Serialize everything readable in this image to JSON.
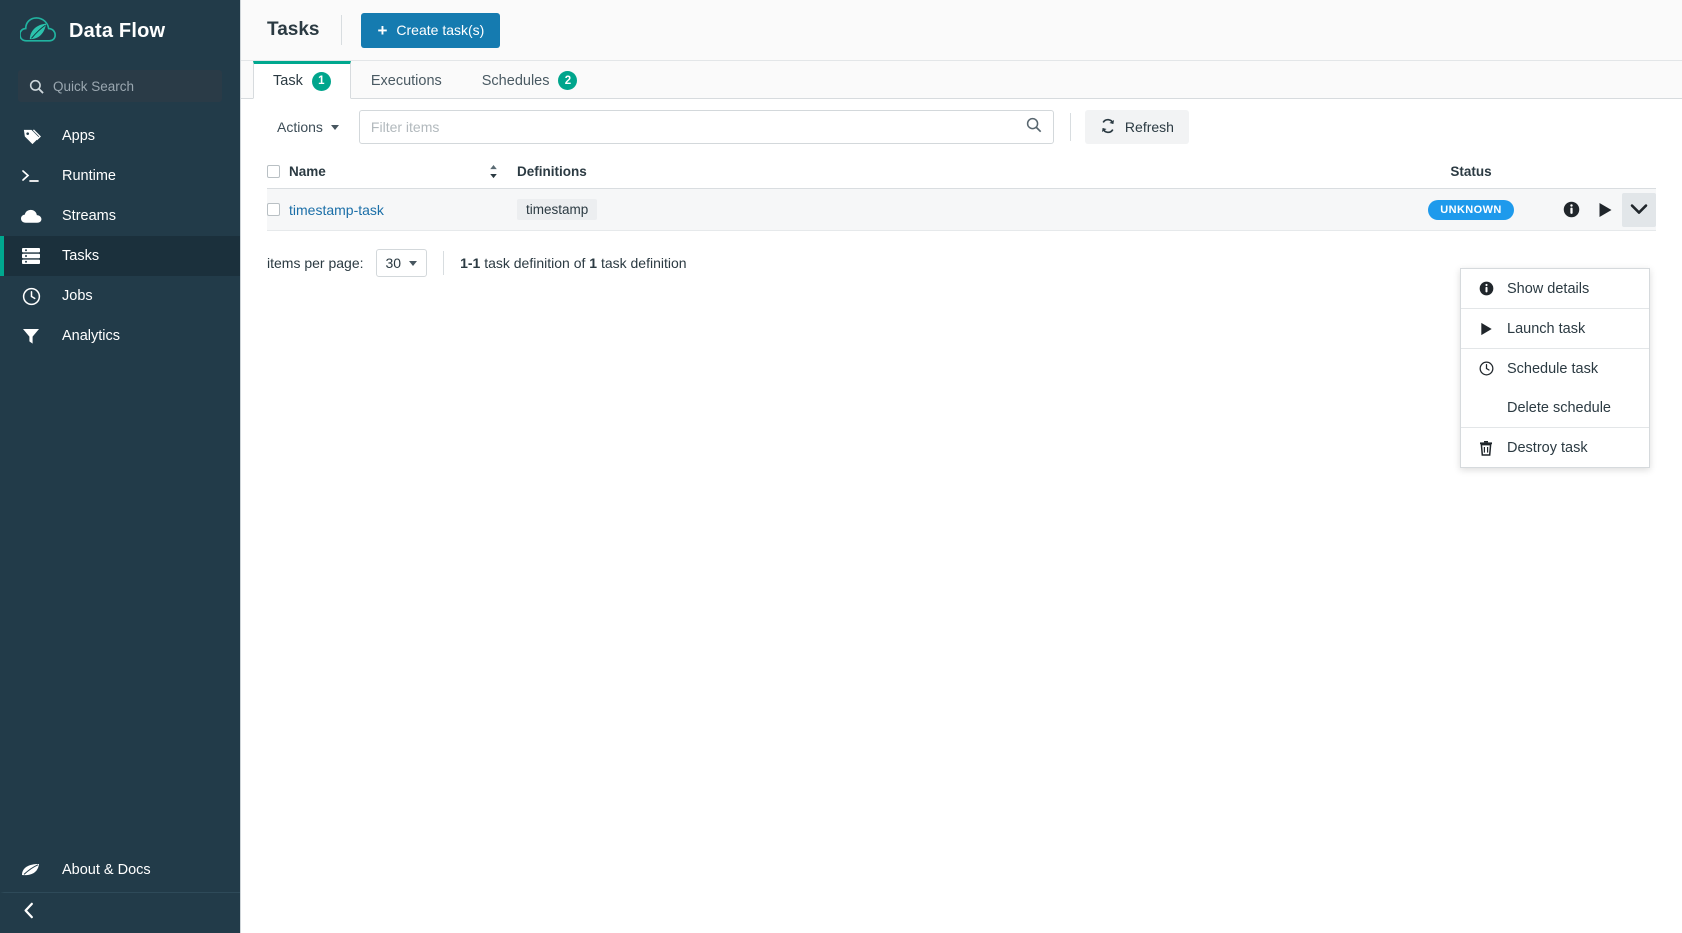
{
  "sidebar": {
    "brand": {
      "title": "Data Flow",
      "logo_icon": "spring-cloud-leaf-logo"
    },
    "search": {
      "placeholder": "Quick Search",
      "icon": "search-icon"
    },
    "items": [
      {
        "label": "Apps",
        "icon": "tag-icon",
        "active": false
      },
      {
        "label": "Runtime",
        "icon": "terminal-icon",
        "active": false
      },
      {
        "label": "Streams",
        "icon": "cloud-icon",
        "active": false
      },
      {
        "label": "Tasks",
        "icon": "tasks-icon",
        "active": true
      },
      {
        "label": "Jobs",
        "icon": "clock-icon",
        "active": false
      },
      {
        "label": "Analytics",
        "icon": "funnel-icon",
        "active": false
      }
    ],
    "about": {
      "label": "About & Docs",
      "icon": "leaf-icon"
    },
    "collapse": {
      "icon": "chevron-left-icon"
    }
  },
  "header": {
    "title": "Tasks",
    "create_button": {
      "label": "Create task(s)",
      "icon": "plus-icon"
    }
  },
  "tabs": [
    {
      "label": "Task",
      "badge": "1",
      "active": true
    },
    {
      "label": "Executions",
      "badge": "",
      "active": false
    },
    {
      "label": "Schedules",
      "badge": "2",
      "active": false
    }
  ],
  "toolbar": {
    "actions_label": "Actions",
    "filter_placeholder": "Filter items",
    "filter_value": "",
    "search_icon": "search-icon",
    "refresh_label": "Refresh",
    "refresh_icon": "refresh-icon"
  },
  "table": {
    "columns": {
      "name": "Name",
      "definitions": "Definitions",
      "status": "Status"
    },
    "rows": [
      {
        "name": "timestamp-task",
        "definition": "timestamp",
        "status": "UNKNOWN",
        "actions": {
          "details_icon": "info-icon",
          "launch_icon": "play-icon",
          "more_icon": "chevron-down-icon"
        }
      }
    ]
  },
  "pagination": {
    "label": "items per page:",
    "page_size": "30",
    "info_prefix": "1-1",
    "info_middle": " task definition of ",
    "info_count": "1",
    "info_suffix": " task definition"
  },
  "dropdown_menu": {
    "groups": [
      [
        {
          "label": "Show details",
          "icon": "info-icon"
        }
      ],
      [
        {
          "label": "Launch task",
          "icon": "play-icon"
        }
      ],
      [
        {
          "label": "Schedule task",
          "icon": "clock-icon"
        },
        {
          "label": "Delete schedule",
          "icon": ""
        }
      ],
      [
        {
          "label": "Destroy task",
          "icon": "trash-icon"
        }
      ]
    ]
  },
  "colors": {
    "sidebar_bg": "#223b49",
    "sidebar_active_bg": "#1b303c",
    "accent_teal": "#00a88f",
    "primary_blue": "#157bb0",
    "status_blue": "#1e9aec",
    "link_blue": "#1b6fa8"
  }
}
